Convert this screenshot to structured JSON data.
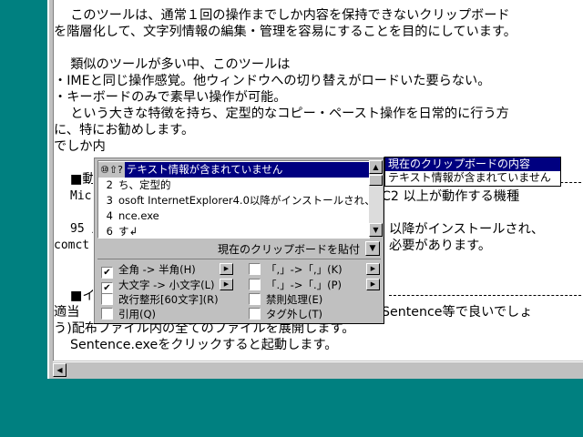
{
  "document": {
    "lines": [
      "　このツールは、通常１回の操作までしか内容を保持できないクリップボード",
      "を階層化して、文字列情報の編集・管理を容易にすることを目的にしています。",
      "",
      "　類似のツールが多い中、このツールは",
      "・IMEと同じ操作感覚。他ウィンドウへの切り替えがロードいた要らない。",
      "・キーボードのみで素早い操作が可能。",
      "　という大きな特徴を持ち、定型的なコピー・ペースト操作を日常的に行う方",
      "に、特にお勧めします。",
      "でしか内"
    ],
    "section1_head": "■動",
    "line_micr": "Micr",
    "line_micr_tail": "C2 以上が動作する機種",
    "line_95": "95 /",
    "line_95_tail": "以降がインストールされ、",
    "line_comct": "comct",
    "line_comct_tail": "必要があります。",
    "section2_head": "■イ",
    "line_tekito": "適当",
    "line_tekito_tail": "Sentence等で良いでしょ",
    "line_u": "う)配布ファイル内の全てのファイルを展開します。",
    "line_exe": "Sentence.exeをクリックすると起動します。"
  },
  "popup": {
    "top_icons": "⑩⇧?",
    "list": [
      {
        "num": "",
        "text": "テキスト情報が含まれていません",
        "selected": true
      },
      {
        "num": "2",
        "text": "ち、定型的"
      },
      {
        "num": "3",
        "text": "osoft InternetExplorer4.0以降がインストールされ、..."
      },
      {
        "num": "4",
        "text": "nce.exe"
      },
      {
        "num": "6",
        "text": "す↲"
      }
    ],
    "paste_label": "現在のクリップボードを貼付",
    "options": [
      {
        "label": "全角 -> 半角(H)",
        "checked": true
      },
      {
        "label": "「,」->「,」(K)",
        "checked": false
      },
      {
        "label": "大文字 -> 小文字(L)",
        "checked": true
      },
      {
        "label": "「.」->「.」(P)",
        "checked": false
      },
      {
        "label": "改行整形[60文字](R)",
        "checked": false
      },
      {
        "label": "禁則処理(E)",
        "checked": false
      },
      {
        "label": "引用(Q)",
        "checked": false
      },
      {
        "label": "タグ外し(T)",
        "checked": false
      }
    ]
  },
  "tooltip": {
    "title": "現在のクリップボードの内容",
    "body": "テキスト情報が含まれていません"
  },
  "icons": {
    "scroll_up": "▲",
    "scroll_down": "▼",
    "scroll_left": "◀",
    "arrow_right": "▶",
    "check": "✔"
  }
}
